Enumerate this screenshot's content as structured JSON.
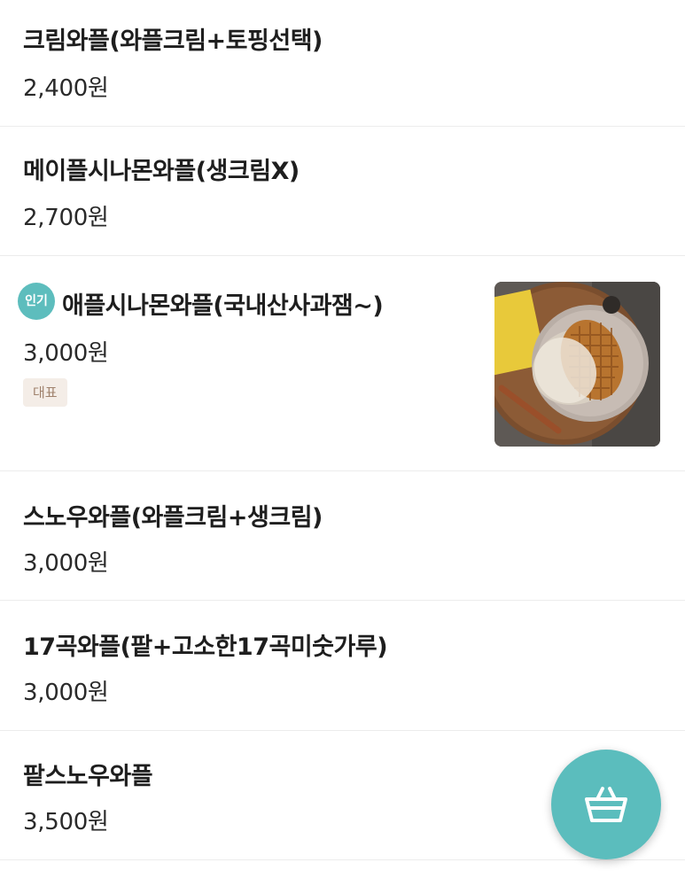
{
  "menu": {
    "items": [
      {
        "name": "크림와플(와플크림+토핑선택)",
        "price": "2,400원"
      },
      {
        "name": "메이플시나몬와플(생크림X)",
        "price": "2,700원"
      },
      {
        "name": "애플시나몬와플(국내산사과잼~)",
        "price": "3,000원",
        "badge": "인기",
        "tag": "대표",
        "image": "apple-cinnamon-waffle-photo"
      },
      {
        "name": "스노우와플(와플크림+생크림)",
        "price": "3,000원"
      },
      {
        "name": "17곡와플(팥+고소한17곡미숫가루)",
        "price": "3,000원"
      },
      {
        "name": "팥스노우와플",
        "price": "3,500원"
      }
    ]
  },
  "cart_button": {
    "icon": "basket-icon"
  },
  "colors": {
    "accent": "#5bbdbd",
    "tag_bg": "#f4ede7",
    "tag_text": "#a0826d",
    "divider": "#ececec"
  }
}
